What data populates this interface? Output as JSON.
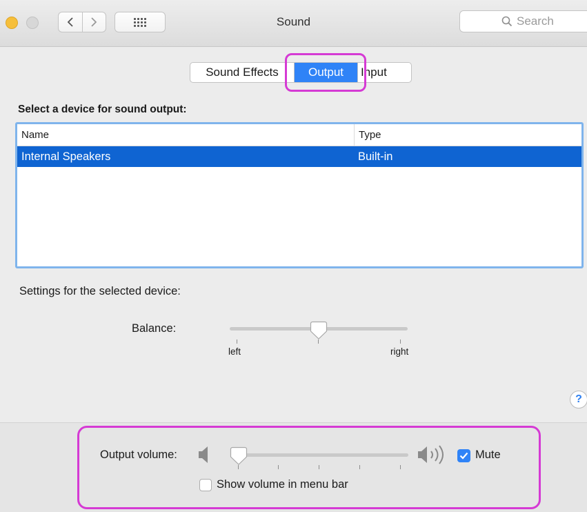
{
  "window": {
    "title": "Sound"
  },
  "search": {
    "placeholder": "Search"
  },
  "tabs": [
    {
      "label": "Sound Effects",
      "selected": false
    },
    {
      "label": "Output",
      "selected": true
    },
    {
      "label": "Input",
      "selected": false
    }
  ],
  "output": {
    "heading": "Select a device for sound output:",
    "columns": {
      "name": "Name",
      "type": "Type"
    },
    "devices": [
      {
        "name": "Internal Speakers",
        "type": "Built-in",
        "selected": true
      }
    ]
  },
  "settings": {
    "heading": "Settings for the selected device:",
    "balance": {
      "label": "Balance:",
      "left_label": "left",
      "right_label": "right",
      "value": 0.5
    }
  },
  "help": {
    "glyph": "?"
  },
  "volume": {
    "label": "Output volume:",
    "value": 0.05,
    "mute_label": "Mute",
    "mute_checked": true,
    "menubar_label": "Show volume in menu bar",
    "menubar_checked": false
  },
  "colors": {
    "accent": "#2f83f7",
    "selection": "#0f64d2",
    "annotation": "#d53ad4",
    "traffic_light_yellow": "#f6bf3b"
  }
}
